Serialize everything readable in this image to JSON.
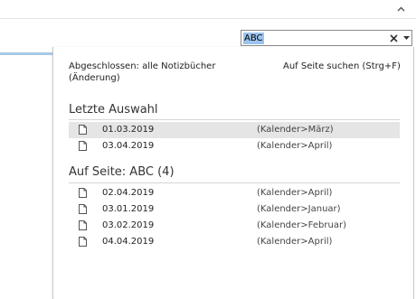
{
  "search": {
    "value": "ABC",
    "clear_glyph": "✕",
    "dropdown_glyph": "▼"
  },
  "ribbon": {
    "collapse_glyph": "⌃"
  },
  "panel": {
    "scope_line1": "Abgeschlossen: alle Notizbücher",
    "scope_line2": "(Änderung)",
    "search_page_link": "Auf Seite suchen (Strg+F)",
    "recent": {
      "header": "Letzte Auswahl",
      "items": [
        {
          "title": "01.03.2019",
          "path": "(Kalender>März)",
          "selected": true
        },
        {
          "title": "03.04.2019",
          "path": "(Kalender>April)",
          "selected": false
        }
      ]
    },
    "on_page": {
      "header": "Auf Seite: ABC (4)",
      "items": [
        {
          "title": "02.04.2019",
          "path": "(Kalender>April)"
        },
        {
          "title": "03.01.2019",
          "path": "(Kalender>Januar)"
        },
        {
          "title": "03.02.2019",
          "path": "(Kalender>Februar)"
        },
        {
          "title": "04.04.2019",
          "path": "(Kalender>April)"
        }
      ]
    }
  },
  "icons": {
    "page": "page-icon",
    "clear": "close-icon",
    "dropdown": "chevron-down-icon",
    "collapse": "chevron-up-icon"
  },
  "colors": {
    "selection_highlight": "#9cc3ee",
    "selected_row": "#e5e5e5",
    "accent_line": "#a9c8e7"
  }
}
